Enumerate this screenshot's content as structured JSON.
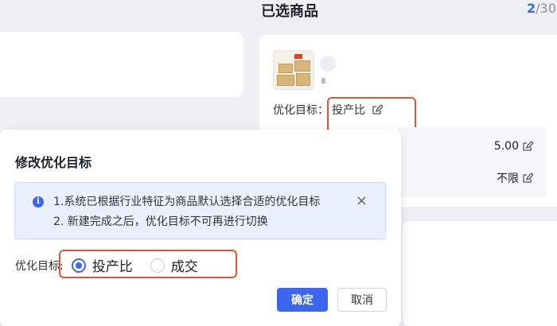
{
  "panel": {
    "title": "已选商品",
    "count_current": "2",
    "count_rest": "/30"
  },
  "product": {
    "goal_label": "优化目标：",
    "goal_value": "投产比",
    "metrics": [
      {
        "value": "5.00"
      },
      {
        "value": "不限"
      }
    ]
  },
  "dialog": {
    "title": "修改优化目标",
    "notice": {
      "line1": "1.系统已根据行业特征为商品默认选择合适的优化目标",
      "line2": "2. 新建完成之后，优化目标不可再进行切换",
      "close": "×"
    },
    "goal_label": "优化目标:",
    "options": [
      {
        "label": "投产比",
        "checked": true
      },
      {
        "label": "成交",
        "checked": false
      }
    ],
    "confirm_label": "确定",
    "cancel_label": "取消"
  },
  "colors": {
    "accent": "#3a66f0",
    "highlight": "#e0562f"
  }
}
